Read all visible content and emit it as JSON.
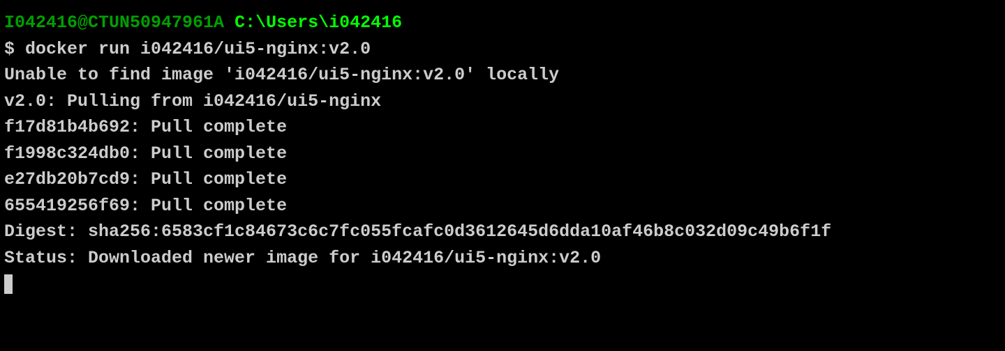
{
  "prompt": {
    "user_host": "I042416@CTUN50947961A",
    "path": "C:\\Users\\i042416",
    "symbol": "$"
  },
  "command": "docker run i042416/ui5-nginx:v2.0",
  "output_lines": [
    "Unable to find image 'i042416/ui5-nginx:v2.0' locally",
    "v2.0: Pulling from i042416/ui5-nginx",
    "f17d81b4b692: Pull complete",
    "f1998c324db0: Pull complete",
    "e27db20b7cd9: Pull complete",
    "655419256f69: Pull complete",
    "Digest: sha256:6583cf1c84673c6c7fc055fcafc0d3612645d6dda10af46b8c032d09c49b6f1f",
    "Status: Downloaded newer image for i042416/ui5-nginx:v2.0"
  ]
}
